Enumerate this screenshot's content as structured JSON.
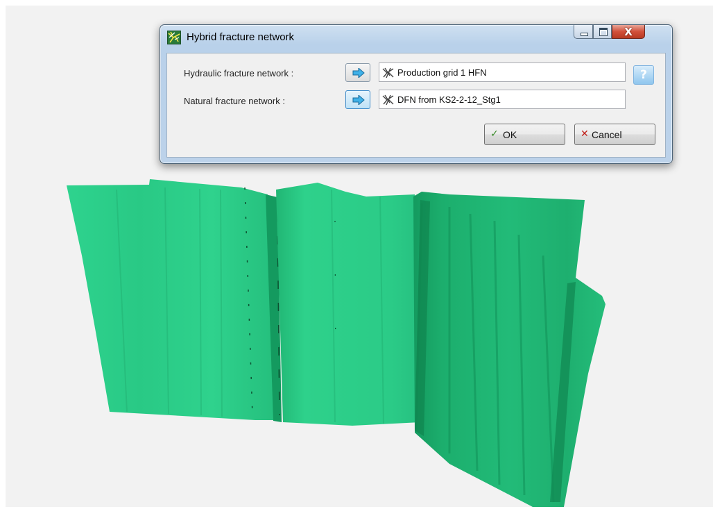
{
  "dialog": {
    "title": "Hybrid fracture network",
    "hydraulic": {
      "label": "Hydraulic fracture network :",
      "value": "Production grid 1 HFN",
      "value_icon": "fracture-network-icon"
    },
    "natural": {
      "label": "Natural fracture network :",
      "value": "DFN from KS2-2-12_Stg1",
      "value_icon": "fracture-network-icon"
    },
    "ok_label": "OK",
    "cancel_label": "Cancel",
    "help_label": "?",
    "close_glyph": "X"
  },
  "scene": {
    "surface_color": "#2ecf8a",
    "surface_dark": "#1fae70",
    "background": "#f2f2f2"
  }
}
